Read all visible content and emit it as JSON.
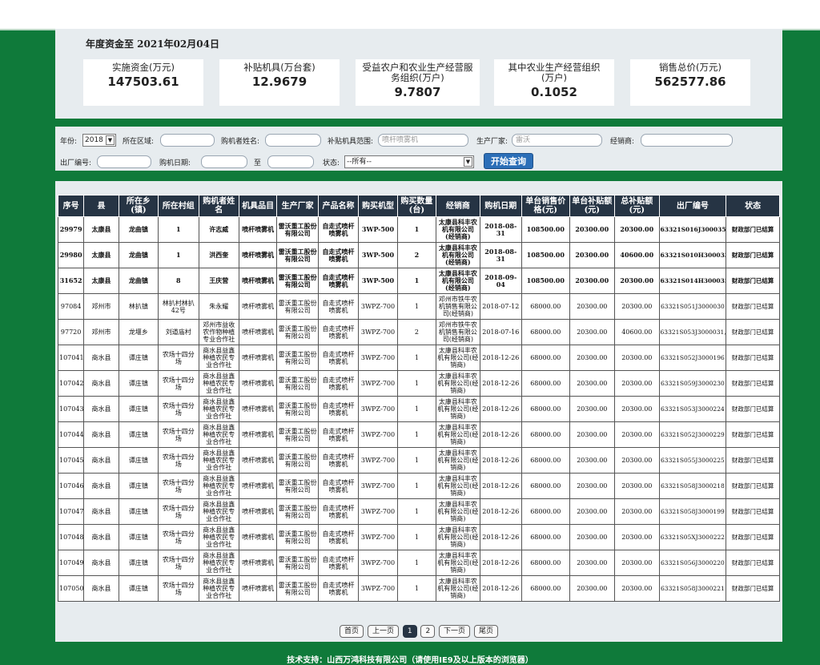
{
  "summary": {
    "header": "年度资金至 2021年02月04日",
    "cards": [
      {
        "label": "实施资金(万元)",
        "value": "147503.61"
      },
      {
        "label": "补贴机具(万台套)",
        "value": "12.9679"
      },
      {
        "label": "受益农户和农业生产经营服务组织(万户)",
        "value": "9.7807"
      },
      {
        "label": "其中农业生产经营组织(万户)",
        "value": "0.1052"
      },
      {
        "label": "销售总价(万元)",
        "value": "562577.86"
      }
    ]
  },
  "filter": {
    "year_label": "年份:",
    "year_value": "2018",
    "region_label": "所在区域:",
    "buyer_label": "购机者姓名:",
    "scope_label": "补贴机具范围:",
    "scope_placeholder": "喷杆喷雾机",
    "maker_label": "生产厂家:",
    "maker_placeholder": "雷沃",
    "dealer_label": "经销商:",
    "serial_label": "出厂编号:",
    "date_label": "购机日期:",
    "date_to": "至",
    "status_label": "状态:",
    "status_value": "--所有--",
    "query_button": "开始查询"
  },
  "table": {
    "columns": [
      "序号",
      "县",
      "所在乡(镇)",
      "所在村组",
      "购机者姓名",
      "机具品目",
      "生产厂家",
      "产品名称",
      "购买机型",
      "购买数量(台)",
      "经销商",
      "购机日期",
      "单台销售价格(元)",
      "单台补贴额(元)",
      "总补贴额(元)",
      "出厂编号",
      "状态"
    ],
    "rows": [
      [
        "29979",
        "太康县",
        "龙曲镇",
        "1",
        "许志威",
        "喷杆喷雾机",
        "雷沃重工股份有限公司",
        "自走式喷杆喷雾机",
        "3WP-500",
        "1",
        "太康县科丰农机有限公司(经销商)",
        "2018-08-31",
        "108500.00",
        "20300.00",
        "20300.00",
        "63321S016J3000358",
        "财政部门已结算"
      ],
      [
        "29980",
        "太康县",
        "龙曲镇",
        "1",
        "洪西奎",
        "喷杆喷雾机",
        "雷沃重工股份有限公司",
        "自走式喷杆喷雾机",
        "3WP-500",
        "2",
        "太康县科丰农机有限公司(经销商)",
        "2018-08-31",
        "108500.00",
        "20300.00",
        "40600.00",
        "63321S010H3000334,LA0079GH",
        "财政部门已结算"
      ],
      [
        "31652",
        "太康县",
        "龙曲镇",
        "8",
        "王庆营",
        "喷杆喷雾机",
        "雷沃重工股份有限公司",
        "自走式喷杆喷雾机",
        "3WP-500",
        "1",
        "太康县科丰农机有限公司(经销商)",
        "2018-09-04",
        "108500.00",
        "20300.00",
        "20300.00",
        "63321S014H3000353",
        "财政部门已结算"
      ],
      [
        "97084",
        "邓州市",
        "林扒镇",
        "林扒村林扒42号",
        "朱永耀",
        "喷杆喷雾机",
        "雷沃重工股份有限公司",
        "自走式喷杆喷雾机",
        "3WPZ-700",
        "1",
        "邓州市铁牛农机销售有限公司(经销商)",
        "2018-07-12",
        "68000.00",
        "20300.00",
        "20300.00",
        "63321S051J3000030",
        "财政部门已结算"
      ],
      [
        "97720",
        "邓州市",
        "龙堰乡",
        "刘道庙村",
        "邓州市益收农作物种植专业合作社",
        "喷杆喷雾机",
        "雷沃重工股份有限公司",
        "自走式喷杆喷雾机",
        "3WPZ-700",
        "2",
        "邓州市铁牛农机销售有限公司(经销商)",
        "2018-07-16",
        "68000.00",
        "20300.00",
        "40600.00",
        "63321S053J3000031,63321S055J3000029",
        "财政部门已结算"
      ],
      [
        "107041",
        "商水县",
        "谭庄镇",
        "农场十四分场",
        "商水县益鑫种植农民专业合作社",
        "喷杆喷雾机",
        "雷沃重工股份有限公司",
        "自走式喷杆喷雾机",
        "3WPZ-700",
        "1",
        "太康县科丰农机有限公司(经销商)",
        "2018-12-26",
        "68000.00",
        "20300.00",
        "20300.00",
        "63321S052J3000196",
        "财政部门已结算"
      ],
      [
        "107042",
        "商水县",
        "谭庄镇",
        "农场十四分场",
        "商水县益鑫种植农民专业合作社",
        "喷杆喷雾机",
        "雷沃重工股份有限公司",
        "自走式喷杆喷雾机",
        "3WPZ-700",
        "1",
        "太康县科丰农机有限公司(经销商)",
        "2018-12-26",
        "68000.00",
        "20300.00",
        "20300.00",
        "63321S059J3000230",
        "财政部门已结算"
      ],
      [
        "107043",
        "商水县",
        "谭庄镇",
        "农场十四分场",
        "商水县益鑫种植农民专业合作社",
        "喷杆喷雾机",
        "雷沃重工股份有限公司",
        "自走式喷杆喷雾机",
        "3WPZ-700",
        "1",
        "太康县科丰农机有限公司(经销商)",
        "2018-12-26",
        "68000.00",
        "20300.00",
        "20300.00",
        "63321S053J3000224",
        "财政部门已结算"
      ],
      [
        "107044",
        "商水县",
        "谭庄镇",
        "农场十四分场",
        "商水县益鑫种植农民专业合作社",
        "喷杆喷雾机",
        "雷沃重工股份有限公司",
        "自走式喷杆喷雾机",
        "3WPZ-700",
        "1",
        "太康县科丰农机有限公司(经销商)",
        "2018-12-26",
        "68000.00",
        "20300.00",
        "20300.00",
        "63321S052J3000229",
        "财政部门已结算"
      ],
      [
        "107045",
        "商水县",
        "谭庄镇",
        "农场十四分场",
        "商水县益鑫种植农民专业合作社",
        "喷杆喷雾机",
        "雷沃重工股份有限公司",
        "自走式喷杆喷雾机",
        "3WPZ-700",
        "1",
        "太康县科丰农机有限公司(经销商)",
        "2018-12-26",
        "68000.00",
        "20300.00",
        "20300.00",
        "63321S055J3000225",
        "财政部门已结算"
      ],
      [
        "107046",
        "商水县",
        "谭庄镇",
        "农场十四分场",
        "商水县益鑫种植农民专业合作社",
        "喷杆喷雾机",
        "雷沃重工股份有限公司",
        "自走式喷杆喷雾机",
        "3WPZ-700",
        "1",
        "太康县科丰农机有限公司(经销商)",
        "2018-12-26",
        "68000.00",
        "20300.00",
        "20300.00",
        "63321S058J3000218",
        "财政部门已结算"
      ],
      [
        "107047",
        "商水县",
        "谭庄镇",
        "农场十四分场",
        "商水县益鑫种植农民专业合作社",
        "喷杆喷雾机",
        "雷沃重工股份有限公司",
        "自走式喷杆喷雾机",
        "3WPZ-700",
        "1",
        "太康县科丰农机有限公司(经销商)",
        "2018-12-26",
        "68000.00",
        "20300.00",
        "20300.00",
        "63321S058J3000199",
        "财政部门已结算"
      ],
      [
        "107048",
        "商水县",
        "谭庄镇",
        "农场十四分场",
        "商水县益鑫种植农民专业合作社",
        "喷杆喷雾机",
        "雷沃重工股份有限公司",
        "自走式喷杆喷雾机",
        "3WPZ-700",
        "1",
        "太康县科丰农机有限公司(经销商)",
        "2018-12-26",
        "68000.00",
        "20300.00",
        "20300.00",
        "63321S05XJ3000222",
        "财政部门已结算"
      ],
      [
        "107049",
        "商水县",
        "谭庄镇",
        "农场十四分场",
        "商水县益鑫种植农民专业合作社",
        "喷杆喷雾机",
        "雷沃重工股份有限公司",
        "自走式喷杆喷雾机",
        "3WPZ-700",
        "1",
        "太康县科丰农机有限公司(经销商)",
        "2018-12-26",
        "68000.00",
        "20300.00",
        "20300.00",
        "63321S056J3000220",
        "财政部门已结算"
      ],
      [
        "107050",
        "商水县",
        "谭庄镇",
        "农场十四分场",
        "商水县益鑫种植农民专业合作社",
        "喷杆喷雾机",
        "雷沃重工股份有限公司",
        "自走式喷杆喷雾机",
        "3WPZ-700",
        "1",
        "太康县科丰农机有限公司(经销商)",
        "2018-12-26",
        "68000.00",
        "20300.00",
        "20300.00",
        "63321S058J3000221",
        "财政部门已结算"
      ]
    ]
  },
  "pager": {
    "first": "首页",
    "prev": "上一页",
    "p1": "1",
    "p2": "2",
    "next": "下一页",
    "last": "尾页"
  },
  "footer": "技术支持：山西万鸿科技有限公司（请使用IE9及以上版本的浏览器）"
}
